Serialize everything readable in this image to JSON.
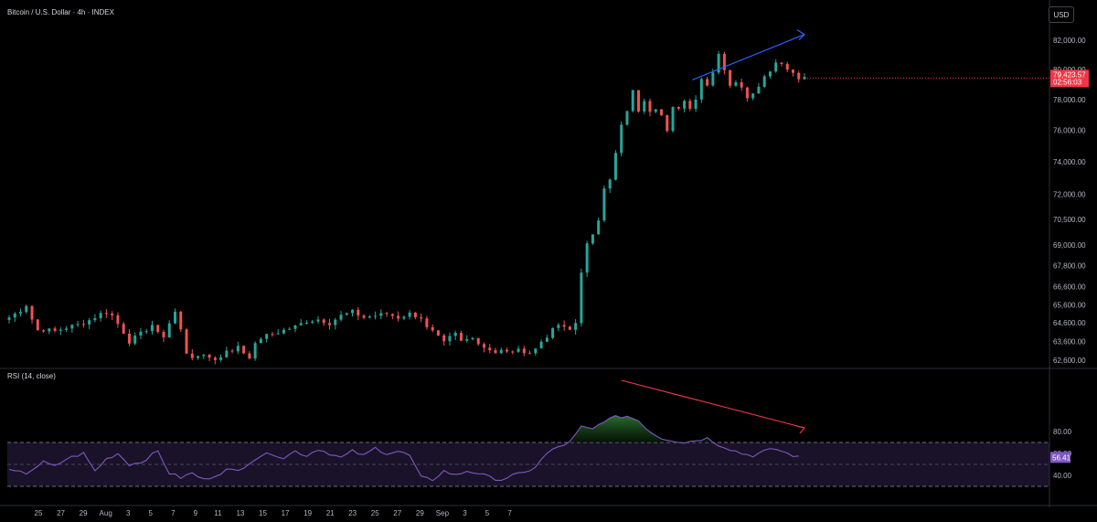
{
  "header": {
    "symbol_title": "Bitcoin / U.S. Dollar · 4h · INDEX",
    "currency_button": "USD"
  },
  "rsi_panel": {
    "title": "RSI (14, close)"
  },
  "colors": {
    "up": "#26a69a",
    "down": "#ef5350",
    "rsi_line": "#7e57c2",
    "rsi_band": "#1a1228",
    "price_tag": "#f23645",
    "rsi_tag": "#7e57c2",
    "trend_up": "#2962ff",
    "trend_down": "#f23645",
    "overbought_fill": "#1b5e20"
  },
  "chart_data": [
    {
      "type": "candlestick",
      "title": "Bitcoin / U.S. Dollar · 4h · INDEX",
      "y_ticks": [
        "82,000.00",
        "80,000.00",
        "78,000.00",
        "76,000.00",
        "74,000.00",
        "72,000.00",
        "70,500.00",
        "69,000.00",
        "67,800.00",
        "66,600.00",
        "65,600.00",
        "64,600.00",
        "63,600.00",
        "62,600.00"
      ],
      "scale": "log",
      "x_ticks": [
        "25",
        "27",
        "29",
        "Aug",
        "3",
        "5",
        "7",
        "9",
        "11",
        "13",
        "15",
        "17",
        "19",
        "21",
        "23",
        "25",
        "27",
        "29",
        "Sep",
        "3",
        "5",
        "7"
      ],
      "last_price": "79,423.57",
      "countdown": "02:56:03",
      "path": [
        [
          0,
          64900
        ],
        [
          2,
          65300
        ],
        [
          3,
          65600
        ],
        [
          4,
          64800
        ],
        [
          5,
          64200
        ],
        [
          6,
          64250
        ],
        [
          8,
          64150
        ],
        [
          10,
          64350
        ],
        [
          12,
          64500
        ],
        [
          14,
          64750
        ],
        [
          16,
          65100
        ],
        [
          17,
          65200
        ],
        [
          18,
          65000
        ],
        [
          20,
          64100
        ],
        [
          21,
          63600
        ],
        [
          22,
          63800
        ],
        [
          23,
          64000
        ],
        [
          25,
          64500
        ],
        [
          26,
          64000
        ],
        [
          27,
          63900
        ],
        [
          28,
          64600
        ],
        [
          29,
          65200
        ],
        [
          30,
          64200
        ],
        [
          31,
          63000
        ],
        [
          32,
          62800
        ],
        [
          33,
          62700
        ],
        [
          34,
          62900
        ],
        [
          35,
          62800
        ],
        [
          36,
          62600
        ],
        [
          37,
          62800
        ],
        [
          38,
          63200
        ],
        [
          39,
          63000
        ],
        [
          40,
          63400
        ],
        [
          41,
          63000
        ],
        [
          42,
          62800
        ],
        [
          43,
          63400
        ],
        [
          44,
          63800
        ],
        [
          46,
          64000
        ],
        [
          48,
          64200
        ],
        [
          50,
          64400
        ],
        [
          52,
          64700
        ],
        [
          54,
          64800
        ],
        [
          56,
          64600
        ],
        [
          58,
          65000
        ],
        [
          60,
          65200
        ],
        [
          62,
          64900
        ],
        [
          64,
          65000
        ],
        [
          66,
          65100
        ],
        [
          68,
          64900
        ],
        [
          70,
          65100
        ],
        [
          72,
          64900
        ],
        [
          73,
          64300
        ],
        [
          74,
          64100
        ],
        [
          75,
          63800
        ],
        [
          76,
          63500
        ],
        [
          77,
          63800
        ],
        [
          78,
          64000
        ],
        [
          79,
          63600
        ],
        [
          80,
          63700
        ],
        [
          81,
          63900
        ],
        [
          82,
          63500
        ],
        [
          83,
          63300
        ],
        [
          84,
          63200
        ],
        [
          85,
          63000
        ],
        [
          86,
          63100
        ],
        [
          87,
          63000
        ],
        [
          88,
          63100
        ],
        [
          89,
          63100
        ],
        [
          90,
          63100
        ],
        [
          91,
          63000
        ],
        [
          92,
          63200
        ],
        [
          93,
          63600
        ],
        [
          94,
          63900
        ],
        [
          95,
          64200
        ],
        [
          96,
          64500
        ],
        [
          97,
          64300
        ],
        [
          98,
          64200
        ],
        [
          99,
          64600
        ],
        [
          100,
          67500
        ],
        [
          101,
          69000
        ],
        [
          102,
          69500
        ],
        [
          103,
          70500
        ],
        [
          104,
          72500
        ],
        [
          105,
          73000
        ],
        [
          106,
          74500
        ],
        [
          107,
          76300
        ],
        [
          108,
          77200
        ],
        [
          109,
          78500
        ],
        [
          110,
          77300
        ],
        [
          111,
          77800
        ],
        [
          112,
          77300
        ],
        [
          113,
          77500
        ],
        [
          114,
          77100
        ],
        [
          115,
          76100
        ],
        [
          116,
          77500
        ],
        [
          117,
          77300
        ],
        [
          118,
          77800
        ],
        [
          119,
          77500
        ],
        [
          120,
          78000
        ],
        [
          121,
          79500
        ],
        [
          122,
          79000
        ],
        [
          123,
          79800
        ],
        [
          124,
          81200
        ],
        [
          125,
          80000
        ],
        [
          126,
          79000
        ],
        [
          127,
          79200
        ],
        [
          128,
          78700
        ],
        [
          129,
          78200
        ],
        [
          130,
          78500
        ],
        [
          131,
          79000
        ],
        [
          132,
          79500
        ],
        [
          133,
          80000
        ],
        [
          134,
          80500
        ],
        [
          135,
          80500
        ],
        [
          136,
          80000
        ],
        [
          137,
          79800
        ],
        [
          138,
          79500
        ],
        [
          139,
          79424
        ]
      ]
    },
    {
      "type": "line",
      "title": "RSI (14, close)",
      "y_ticks": [
        "80.00",
        "60.00",
        "40.00"
      ],
      "bands": [
        70,
        50,
        30
      ],
      "last_value": "56.41",
      "path": [
        [
          0,
          44
        ],
        [
          3,
          42
        ],
        [
          6,
          52
        ],
        [
          8,
          48
        ],
        [
          10,
          55
        ],
        [
          13,
          60
        ],
        [
          15,
          44
        ],
        [
          17,
          55
        ],
        [
          19,
          60
        ],
        [
          21,
          50
        ],
        [
          23,
          52
        ],
        [
          26,
          62
        ],
        [
          28,
          42
        ],
        [
          30,
          38
        ],
        [
          32,
          42
        ],
        [
          34,
          36
        ],
        [
          36,
          40
        ],
        [
          38,
          45
        ],
        [
          40,
          44
        ],
        [
          42,
          52
        ],
        [
          44,
          58
        ],
        [
          46,
          60
        ],
        [
          48,
          56
        ],
        [
          50,
          62
        ],
        [
          52,
          58
        ],
        [
          54,
          64
        ],
        [
          56,
          60
        ],
        [
          58,
          56
        ],
        [
          60,
          62
        ],
        [
          62,
          58
        ],
        [
          64,
          65
        ],
        [
          66,
          60
        ],
        [
          68,
          62
        ],
        [
          70,
          58
        ],
        [
          72,
          38
        ],
        [
          74,
          36
        ],
        [
          76,
          44
        ],
        [
          78,
          40
        ],
        [
          80,
          44
        ],
        [
          82,
          42
        ],
        [
          84,
          38
        ],
        [
          86,
          36
        ],
        [
          88,
          40
        ],
        [
          90,
          42
        ],
        [
          92,
          48
        ],
        [
          94,
          60
        ],
        [
          96,
          66
        ],
        [
          98,
          70
        ],
        [
          100,
          84
        ],
        [
          102,
          82
        ],
        [
          104,
          90
        ],
        [
          106,
          93
        ],
        [
          108,
          94
        ],
        [
          110,
          90
        ],
        [
          112,
          80
        ],
        [
          114,
          74
        ],
        [
          116,
          72
        ],
        [
          118,
          70
        ],
        [
          120,
          72
        ],
        [
          122,
          74
        ],
        [
          124,
          68
        ],
        [
          126,
          64
        ],
        [
          128,
          60
        ],
        [
          130,
          58
        ],
        [
          132,
          62
        ],
        [
          134,
          64
        ],
        [
          136,
          60
        ],
        [
          138,
          56.41
        ]
      ]
    }
  ]
}
